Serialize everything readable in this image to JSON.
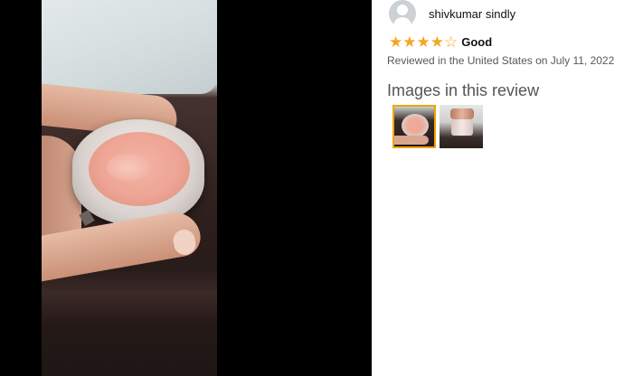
{
  "viewer": {
    "image_description_icon": "photo-of-pink-balm-jar"
  },
  "review": {
    "reviewer_name": "shivkumar sindly",
    "avatar_icon": "default-user-avatar-icon",
    "rating": 4,
    "rating_max": 5,
    "title": "Good",
    "date_text": "Reviewed in the United States on July 11, 2022",
    "star_color": "#f5a623"
  },
  "images": {
    "heading": "Images in this review",
    "thumbnails": [
      {
        "name": "thumbnail-1",
        "selected": true
      },
      {
        "name": "thumbnail-2",
        "selected": false
      }
    ],
    "selected_border_color": "#f0a400"
  }
}
